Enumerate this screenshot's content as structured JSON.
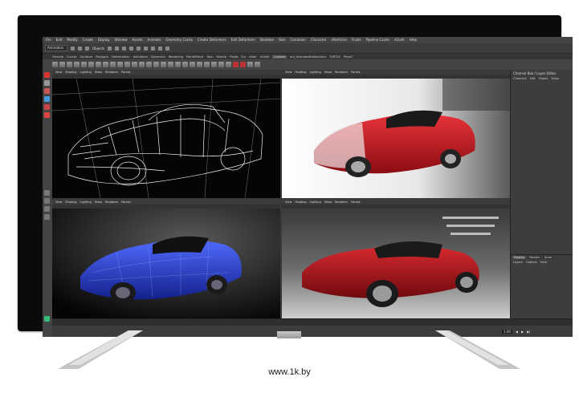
{
  "menubar": {
    "items": [
      "File",
      "Edit",
      "Modify",
      "Create",
      "Display",
      "Window",
      "Assets",
      "Animate",
      "Geometry Cache",
      "Create Deformers",
      "Edit Deformers",
      "Skeleton",
      "Skin",
      "Constrain",
      "Character",
      "nParticles",
      "Fluids",
      "Pipeline Cache",
      "nCloth",
      "Help"
    ]
  },
  "statusline": {
    "mode": "Animation",
    "objects_label": "Objects"
  },
  "shelf": {
    "tabs": [
      "General",
      "Curves",
      "Surfaces",
      "Polygons",
      "Deformation",
      "Animation",
      "Dynamics",
      "Rendering",
      "PaintEffects",
      "Toon",
      "Muscle",
      "Fluids",
      "Fur",
      "nHair",
      "nCloth",
      "Custom",
      "anl_animatedEsSolutions",
      "TURTLE",
      "PhysiC"
    ],
    "active_tab": "Custom"
  },
  "viewport_menu": [
    "View",
    "Shading",
    "Lighting",
    "Show",
    "Renderer",
    "Panels"
  ],
  "channel_box": {
    "title": "Channel Box / Layer Editor",
    "menu": [
      "Channels",
      "Edit",
      "Object",
      "Show"
    ]
  },
  "layer_editor": {
    "tabs": [
      "Display",
      "Render",
      "Anim"
    ],
    "active_tab": "Display",
    "menu": [
      "Layers",
      "Options",
      "Help"
    ]
  },
  "rangebar": {
    "current_frame": "1.00"
  },
  "caption": "www.1k.by",
  "colors": {
    "bezel": "#0b0b0c",
    "maya_ui": "#444444",
    "car_red": "#c0121a",
    "car_blue": "#2a3fd0"
  }
}
